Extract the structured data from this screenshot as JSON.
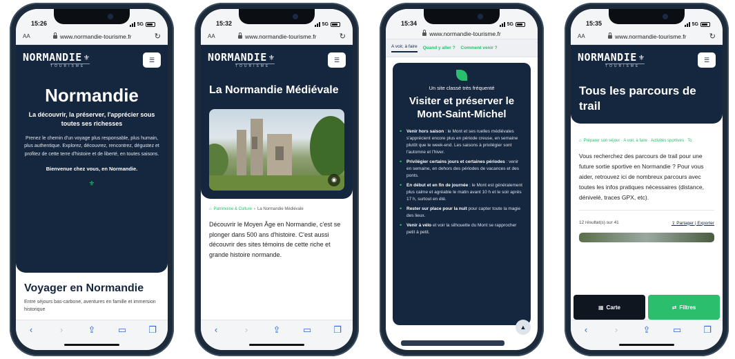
{
  "phones": [
    {
      "time": "15:26",
      "network": "5G",
      "url": "www.normandie-tourisme.fr",
      "logo": "NORMANDIE",
      "logo_sub": "TOURISME",
      "hero_title": "Normandie",
      "hero_subtitle": "La découvrir, la préserver, l'apprécier sous toutes ses richesses",
      "hero_body": "Prenez le chemin d'un voyage plus responsable, plus humain, plus authentique. Explorez, découvrez, rencontrez, dégustez et profitez de cette terre d'histoire et de liberté, en toutes saisons.",
      "welcome": "Bienvenue chez vous, en Normandie.",
      "section_title": "Voyager en Normandie",
      "section_desc": "Entre séjours bas-carbone, aventures en famille et immersion historique"
    },
    {
      "time": "15:32",
      "network": "5G",
      "url": "www.normandie-tourisme.fr",
      "logo": "NORMANDIE",
      "logo_sub": "TOURISME",
      "hero_title": "La Normandie Médiévale",
      "breadcrumb_1": "Patrimoine & Culture",
      "breadcrumb_2": "La Normandie Médiévale",
      "body": "Découvrir le Moyen Âge en Normandie, c'est se plonger dans 500 ans d'histoire. C'est aussi découvrir des sites témoins de cette riche et grande histoire normande."
    },
    {
      "time": "15:34",
      "network": "5G",
      "url": "www.normandie-tourisme.fr",
      "tabs": [
        "A voir, à faire",
        "Quand y aller ?",
        "Comment venir ?"
      ],
      "kicker": "Un site classé très fréquenté",
      "title": "Visiter et préserver le Mont-Saint-Michel",
      "items": [
        {
          "bold": "Venir hors saison",
          "text": " : le Mont et ses ruelles médiévales s'apprécient encore plus en période creuse, en semaine plutôt que le week-end. Les saisons à privilégier sont l'automne et l'hiver."
        },
        {
          "bold": "Privilégier certains jours et certaines périodes",
          "text": " : venir en semaine, en dehors des périodes de vacances et des ponts."
        },
        {
          "bold": "En début et en fin de journée",
          "text": " : le Mont est généralement plus calme et agréable le matin avant 10 h et le soir après 17 h, surtout en été."
        },
        {
          "bold": "Rester sur place pour la nuit",
          "text": " pour capter toute la magie des lieux."
        },
        {
          "bold": "Venir à vélo",
          "text": " et voir la silhouette du Mont se rapprocher petit à petit."
        }
      ]
    },
    {
      "time": "15:35",
      "network": "5G",
      "url": "www.normandie-tourisme.fr",
      "logo": "NORMANDIE",
      "logo_sub": "TOURISME",
      "hero_title": "Tous les parcours de trail",
      "breadcrumb": "Préparer son séjour · A voir, à faire · Activités sportives · To",
      "body": "Vous recherchez des parcours de trail pour une future sortie sportive en Normandie ? Pour vous aider, retrouvez ici de nombreux parcours avec toutes les infos pratiques nécessaires (distance, dénivelé, traces GPX, etc).",
      "results": "12 résultat(s) sur 41",
      "share": "Partager | Exporter",
      "btn_map": "Carte",
      "btn_filters": "Filtres"
    }
  ],
  "browser": {
    "aa": "AA",
    "reload": "↻"
  },
  "colors": {
    "navy": "#15263f",
    "green": "#2bbf6d",
    "safari_blue": "#2a6ad8"
  }
}
